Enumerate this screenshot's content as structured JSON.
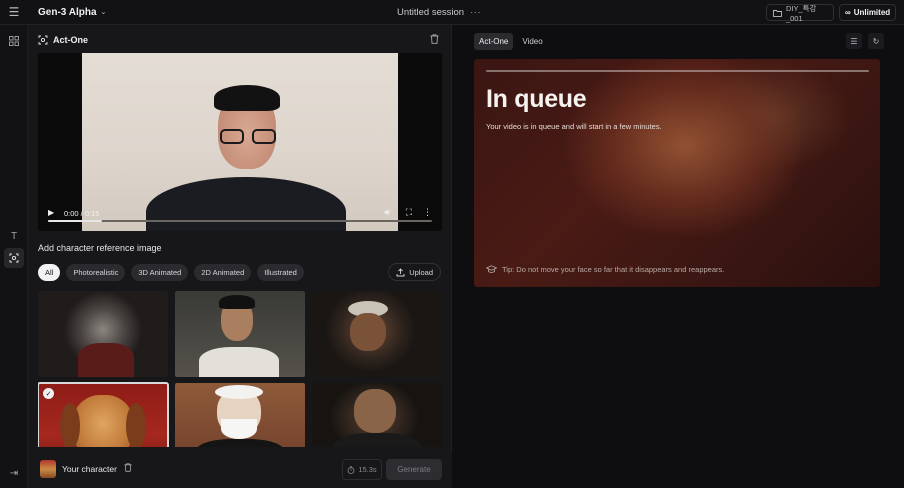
{
  "topbar": {
    "model": "Gen-3 Alpha",
    "session_title": "Untitled session",
    "session_menu": "···",
    "folder": "DIY_특강_001",
    "plan": "Unlimited"
  },
  "left_panel": {
    "tool_title": "Act-One",
    "video": {
      "time": "0:00 / 0:15",
      "progress": 0.14
    },
    "reference_label": "Add character reference image",
    "filters": [
      "All",
      "Photorealistic",
      "3D Animated",
      "2D Animated",
      "Illustrated"
    ],
    "active_filter": "All",
    "upload_label": "Upload",
    "character_label": "Your character",
    "duration": "15.3s",
    "generate_label": "Generate"
  },
  "right_panel": {
    "tabs": [
      "Act-One",
      "Video"
    ],
    "active_tab": "Act-One",
    "queue_title": "In queue",
    "queue_desc": "Your video is in queue and will start in a few minutes.",
    "tip": "Tip: Do not move your face so far that it disappears and reappears."
  },
  "colors": {
    "accent_card": "#4a1b15",
    "chip_active": "#f1f1f3",
    "background": "#0e0e10"
  }
}
